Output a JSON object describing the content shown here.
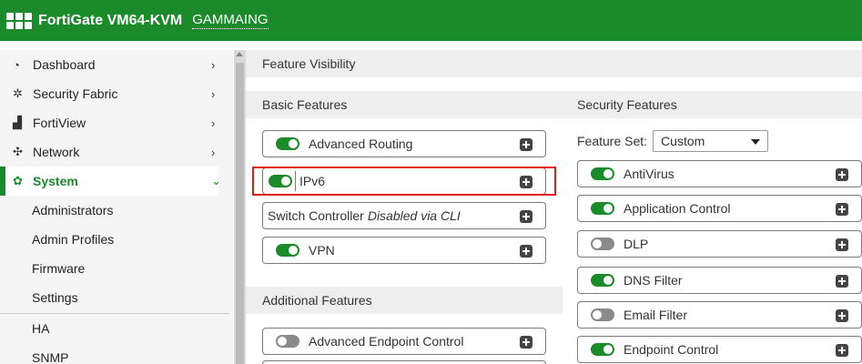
{
  "header": {
    "brand": "FortiGate VM64-KVM",
    "hostname": "GAMMAING",
    "brand_color": "#1b8a2b"
  },
  "sidebar": {
    "items": [
      {
        "label": "Dashboard",
        "icon": "dashboard-icon",
        "glyph": "◔"
      },
      {
        "label": "Security Fabric",
        "icon": "security-fabric-icon",
        "glyph": "✲"
      },
      {
        "label": "FortiView",
        "icon": "fortiview-icon",
        "glyph": "▟"
      },
      {
        "label": "Network",
        "icon": "network-icon",
        "glyph": "✣"
      },
      {
        "label": "System",
        "icon": "gear-icon",
        "glyph": "✿"
      }
    ],
    "chevron_right": "›",
    "chevron_down": "⌄",
    "sub_items": [
      "Administrators",
      "Admin Profiles",
      "Firmware",
      "Settings",
      "HA",
      "SNMP"
    ]
  },
  "main": {
    "title": "Feature Visibility",
    "basic": {
      "heading": "Basic Features",
      "items": [
        {
          "label": "Advanced Routing",
          "state": "on"
        },
        {
          "label": "IPv6",
          "state": "on"
        },
        {
          "label_plain": "Switch Controller ",
          "label_italic": "Disabled via CLI",
          "state": "none"
        },
        {
          "label": "VPN",
          "state": "on"
        }
      ]
    },
    "additional": {
      "heading": "Additional Features",
      "items": [
        {
          "label": "Advanced Endpoint Control",
          "state": "off"
        }
      ]
    },
    "security": {
      "heading": "Security Features",
      "feature_set_label": "Feature Set:",
      "feature_set_value": "Custom",
      "items": [
        {
          "label": "AntiVirus",
          "state": "on"
        },
        {
          "label": "Application Control",
          "state": "on"
        },
        {
          "label": "DLP",
          "state": "off"
        },
        {
          "label": "DNS Filter",
          "state": "on"
        },
        {
          "label": "Email Filter",
          "state": "off"
        },
        {
          "label": "Endpoint Control",
          "state": "on"
        }
      ]
    }
  },
  "highlight_color": "#e21b1b"
}
